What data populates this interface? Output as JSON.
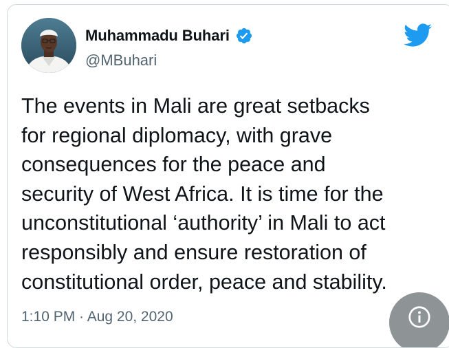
{
  "tweet": {
    "author": {
      "display_name": "Muhammadu Buhari",
      "handle": "@MBuhari",
      "verified": true
    },
    "text": "The events in Mali are great setbacks\nfor regional diplomacy, with grave\nconsequences for the peace and\nsecurity of West Africa. It is time for the\nunconstitutional ‘authority’ in Mali to act\nresponsibly and ensure restoration of\nconstitutional order, peace and stability.",
    "timestamp": "1:10 PM · Aug 20, 2020"
  },
  "icons": {
    "brand": "twitter-bird-icon",
    "verified": "verified-badge-icon",
    "info": "info-icon"
  },
  "colors": {
    "twitter_blue": "#1d9bf0",
    "text_primary": "#0f1419",
    "text_secondary": "#536471",
    "border": "#cfd9de"
  }
}
